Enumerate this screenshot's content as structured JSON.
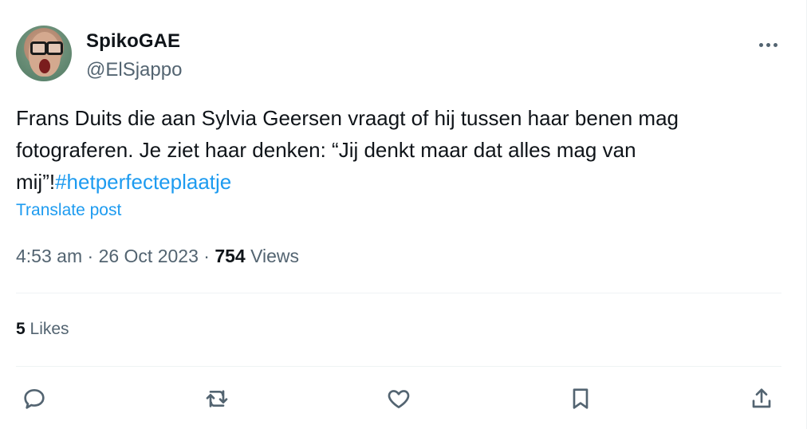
{
  "author": {
    "display_name": "SpikoGAE",
    "handle": "@ElSjappo"
  },
  "tweet": {
    "text": "Frans Duits die aan Sylvia Geersen vraagt of hij tussen haar benen mag fotograferen. Je ziet haar denken: “Jij denkt maar dat alles mag van mij”!",
    "hashtag": "#hetperfecteplaatje",
    "translate_label": "Translate post"
  },
  "meta": {
    "time": "4:53 am",
    "separator": "·",
    "date": "26 Oct 2023",
    "views_count": "754",
    "views_label": "Views"
  },
  "stats": {
    "likes_count": "5",
    "likes_label": "Likes"
  },
  "actions": {
    "icons": [
      "reply-icon",
      "retweet-icon",
      "like-icon",
      "bookmark-icon",
      "share-icon"
    ]
  },
  "colors": {
    "accent": "#1d9bf0",
    "secondary_text": "#536471",
    "primary_text": "#0f1419"
  }
}
